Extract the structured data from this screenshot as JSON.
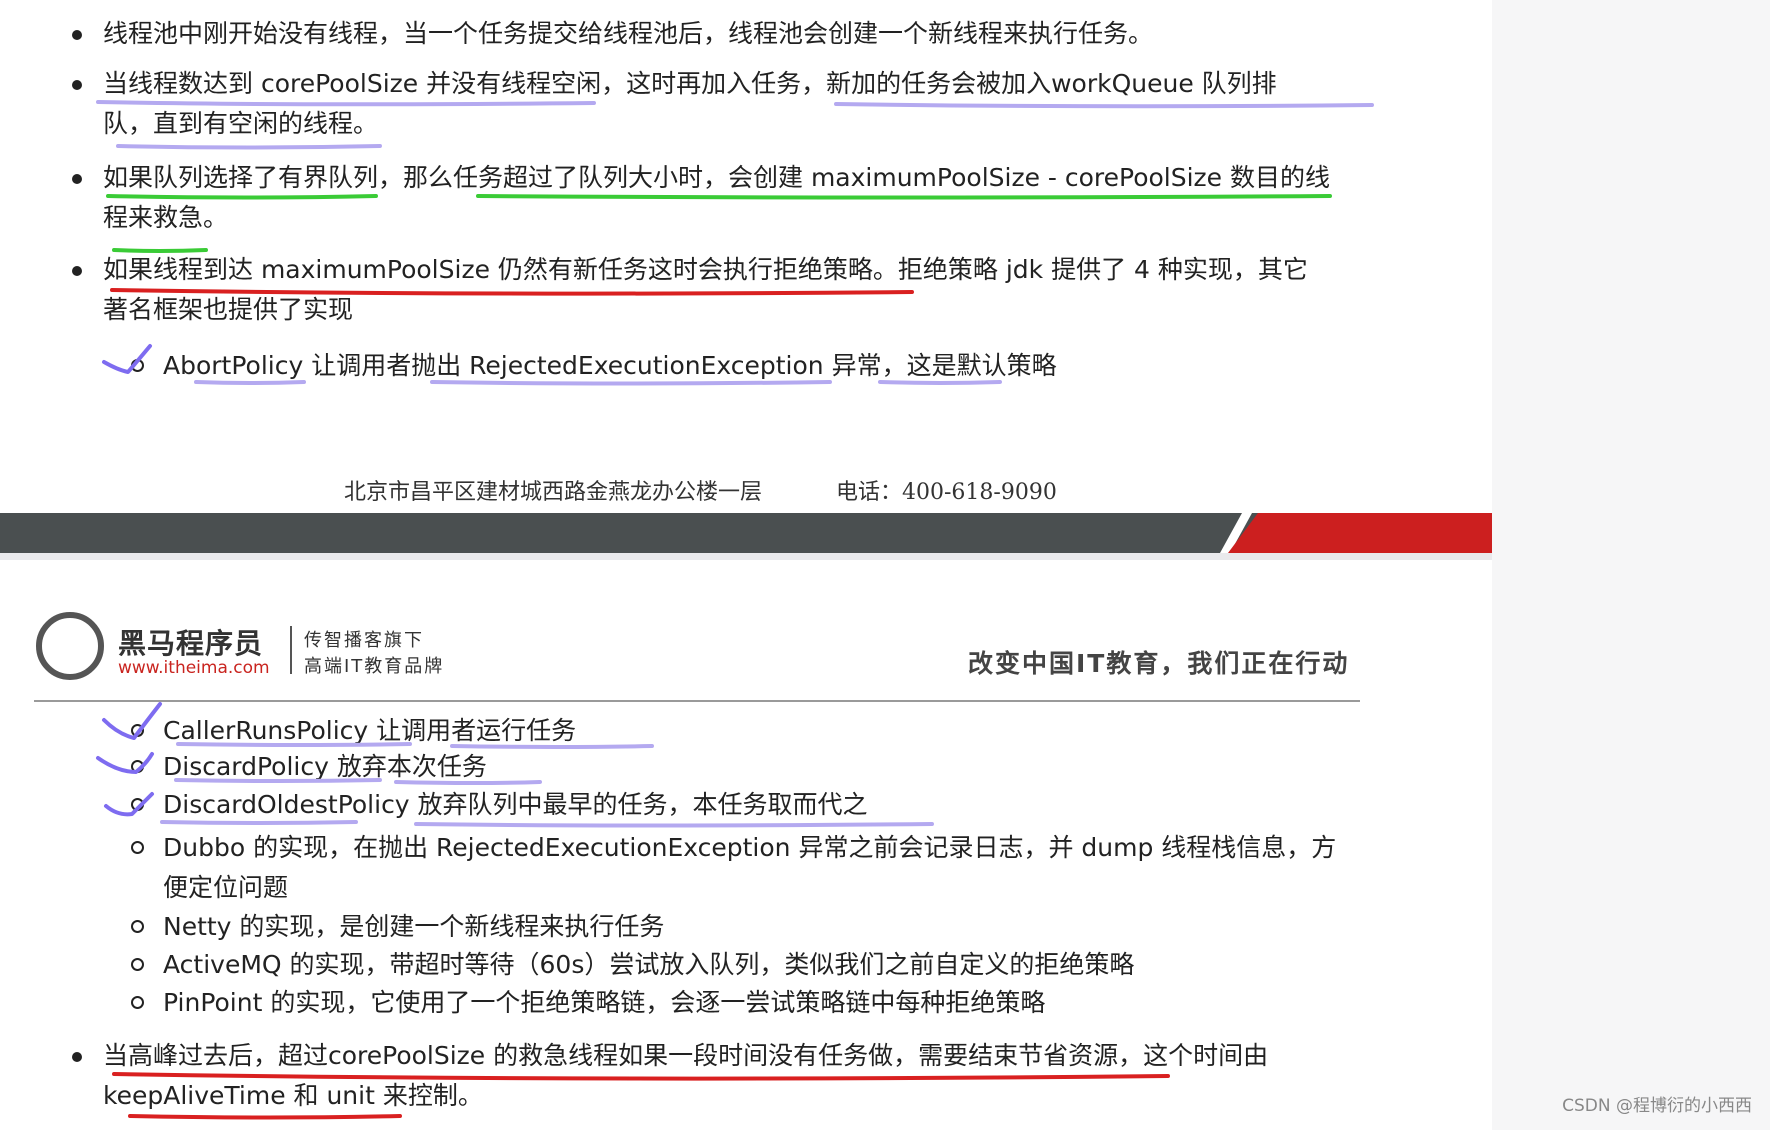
{
  "top_slide": {
    "bullets": [
      {
        "lines": [
          "线程池中刚开始没有线程，当一个任务提交给线程池后，线程池会创建一个新线程来执行任务。"
        ]
      },
      {
        "lines": [
          "当线程数达到 corePoolSize 并没有线程空闲，这时再加入任务，新加的任务会被加入workQueue 队列排",
          "队，直到有空闲的线程。"
        ]
      },
      {
        "lines": [
          "如果队列选择了有界队列，那么任务超过了队列大小时，会创建 maximumPoolSize - corePoolSize 数目的线",
          "程来救急。"
        ]
      },
      {
        "lines": [
          "如果线程到达 maximumPoolSize 仍然有新任务这时会执行拒绝策略。拒绝策略 jdk 提供了 4 种实现，其它",
          "著名框架也提供了实现"
        ]
      }
    ],
    "sub_items": [
      "AbortPolicy 让调用者抛出 RejectedExecutionException 异常，这是默认策略"
    ],
    "footer": {
      "address": "北京市昌平区建材城西路金燕龙办公楼一层",
      "phone": "电话：400-618-9090"
    }
  },
  "bottom_slide": {
    "header": {
      "brand_name": "黑马程序员",
      "brand_url": "www.itheima.com",
      "brand_sub1": "传智播客旗下",
      "brand_sub2": "高端IT教育品牌",
      "slogan": "改变中国IT教育，我们正在行动"
    },
    "sub_items": [
      {
        "lines": [
          "CallerRunsPolicy 让调用者运行任务"
        ]
      },
      {
        "lines": [
          "DiscardPolicy 放弃本次任务"
        ]
      },
      {
        "lines": [
          "DiscardOldestPolicy 放弃队列中最早的任务，本任务取而代之"
        ]
      },
      {
        "lines": [
          "Dubbo 的实现，在抛出 RejectedExecutionException 异常之前会记录日志，并 dump 线程栈信息，方",
          "便定位问题"
        ]
      },
      {
        "lines": [
          "Netty 的实现，是创建一个新线程来执行任务"
        ]
      },
      {
        "lines": [
          "ActiveMQ 的实现，带超时等待（60s）尝试放入队列，类似我们之前自定义的拒绝策略"
        ]
      },
      {
        "lines": [
          "PinPoint 的实现，它使用了一个拒绝策略链，会逐一尝试策略链中每种拒绝策略"
        ]
      }
    ],
    "bullets": [
      {
        "lines": [
          "当高峰过去后，超过corePoolSize 的救急线程如果一段时间没有任务做，需要结束节省资源，这个时间由",
          "keepAliveTime 和 unit 来控制。"
        ]
      }
    ]
  },
  "watermark": "CSDN @程博衍的小西西",
  "colors": {
    "purple_ink": "#b4a9f0",
    "green_ink": "#3acb36",
    "red_ink": "#d92020",
    "band_dark": "#4a4f50",
    "band_red": "#cc1f1f",
    "brand_url": "#c9241f"
  }
}
